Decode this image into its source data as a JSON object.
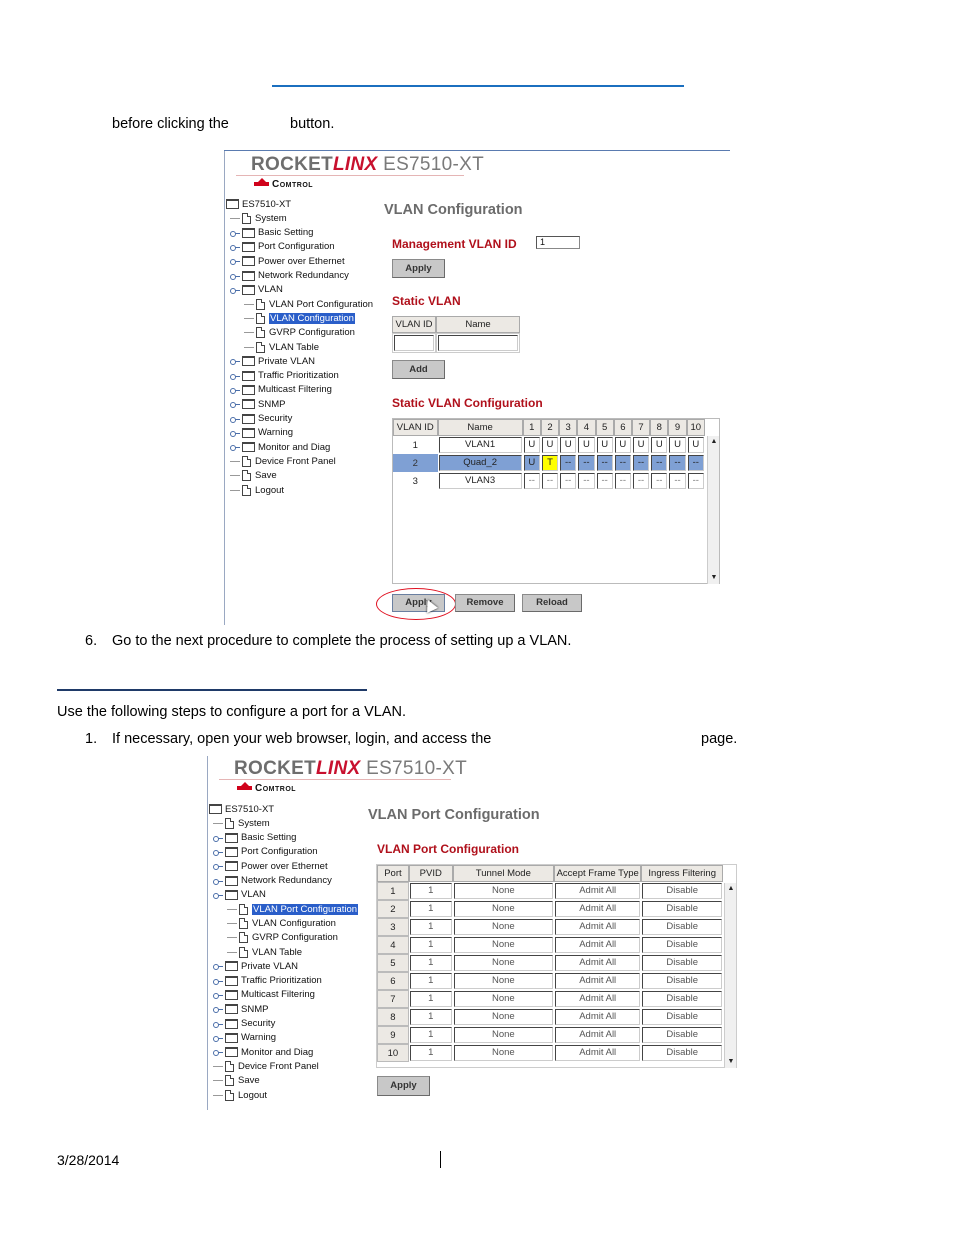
{
  "doc": {
    "intro_line": "before clicking the",
    "intro_line_tail": "button.",
    "step6": "6.",
    "step6_text": "Go to the next procedure to complete the process of setting up a VLAN.",
    "section_intro": "Use the following steps to configure a port for a VLAN.",
    "step1": "1.",
    "step1_text": "If necessary, open your web browser, login, and access the",
    "step1_tail": "page.",
    "footer_date": "3/28/2014"
  },
  "brand": {
    "rocket": "ROCKET",
    "linx": "LINX",
    "model": "ES7510-XT",
    "vendor": "Comtrol"
  },
  "tree": {
    "root": "ES7510-XT",
    "items": [
      {
        "label": "System",
        "type": "page"
      },
      {
        "label": "Basic Setting",
        "type": "folder"
      },
      {
        "label": "Port Configuration",
        "type": "folder"
      },
      {
        "label": "Power over Ethernet",
        "type": "folder"
      },
      {
        "label": "Network Redundancy",
        "type": "folder"
      },
      {
        "label": "VLAN",
        "type": "folder",
        "expanded": true
      },
      {
        "label": "VLAN Port Configuration",
        "type": "page",
        "child": true
      },
      {
        "label": "VLAN Configuration",
        "type": "page",
        "child": true
      },
      {
        "label": "GVRP Configuration",
        "type": "page",
        "child": true
      },
      {
        "label": "VLAN Table",
        "type": "page",
        "child": true
      },
      {
        "label": "Private VLAN",
        "type": "folder"
      },
      {
        "label": "Traffic Prioritization",
        "type": "folder"
      },
      {
        "label": "Multicast Filtering",
        "type": "folder"
      },
      {
        "label": "SNMP",
        "type": "folder"
      },
      {
        "label": "Security",
        "type": "folder"
      },
      {
        "label": "Warning",
        "type": "folder"
      },
      {
        "label": "Monitor and Diag",
        "type": "folder"
      },
      {
        "label": "Device Front Panel",
        "type": "page"
      },
      {
        "label": "Save",
        "type": "page"
      },
      {
        "label": "Logout",
        "type": "page"
      }
    ]
  },
  "vlan_config": {
    "heading": "VLAN Configuration",
    "mgmt_label": "Management VLAN ID",
    "mgmt_value": "1",
    "apply_label": "Apply",
    "static_title": "Static VLAN",
    "static_headers": [
      "VLAN ID",
      "Name"
    ],
    "add_label": "Add",
    "static_cfg_title": "Static VLAN Configuration",
    "cfg_headers": [
      "VLAN ID",
      "Name",
      "1",
      "2",
      "3",
      "4",
      "5",
      "6",
      "7",
      "8",
      "9",
      "10"
    ],
    "rows": [
      {
        "id": "1",
        "name": "VLAN1",
        "ports": [
          "U",
          "U",
          "U",
          "U",
          "U",
          "U",
          "U",
          "U",
          "U",
          "U"
        ],
        "selected": false
      },
      {
        "id": "2",
        "name": "Quad_2",
        "ports": [
          "U",
          "T",
          "--",
          "--",
          "--",
          "--",
          "--",
          "--",
          "--",
          "--"
        ],
        "selected": true
      },
      {
        "id": "3",
        "name": "VLAN3",
        "ports": [
          "--",
          "--",
          "--",
          "--",
          "--",
          "--",
          "--",
          "--",
          "--",
          "--"
        ],
        "selected": false
      }
    ],
    "buttons": {
      "apply": "Apply",
      "remove": "Remove",
      "reload": "Reload"
    },
    "selected_tree_item": "VLAN Configuration"
  },
  "vlan_port_config": {
    "heading": "VLAN Port Configuration",
    "section_title": "VLAN Port Configuration",
    "headers": [
      "Port",
      "PVID",
      "Tunnel Mode",
      "Accept Frame Type",
      "Ingress Filtering"
    ],
    "rows": [
      [
        "1",
        "1",
        "None",
        "Admit All",
        "Disable"
      ],
      [
        "2",
        "1",
        "None",
        "Admit All",
        "Disable"
      ],
      [
        "3",
        "1",
        "None",
        "Admit All",
        "Disable"
      ],
      [
        "4",
        "1",
        "None",
        "Admit All",
        "Disable"
      ],
      [
        "5",
        "1",
        "None",
        "Admit All",
        "Disable"
      ],
      [
        "6",
        "1",
        "None",
        "Admit All",
        "Disable"
      ],
      [
        "7",
        "1",
        "None",
        "Admit All",
        "Disable"
      ],
      [
        "8",
        "1",
        "None",
        "Admit All",
        "Disable"
      ],
      [
        "9",
        "1",
        "None",
        "Admit All",
        "Disable"
      ],
      [
        "10",
        "1",
        "None",
        "Admit All",
        "Disable"
      ]
    ],
    "apply_label": "Apply",
    "selected_tree_item": "VLAN Port Configuration"
  },
  "colors": {
    "accent_red": "#b0101b",
    "selection_blue": "#2a5ec9",
    "row_selected": "#7fa0d4",
    "tag_yellow": "#ffff00",
    "rule_blue": "#1b6fbf"
  }
}
